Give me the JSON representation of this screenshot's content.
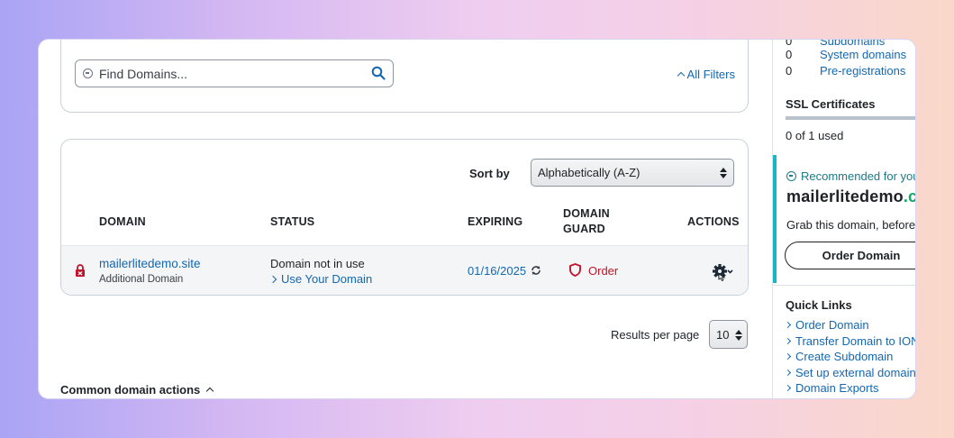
{
  "search": {
    "placeholder": "Find Domains...",
    "all_filters_label": "All Filters"
  },
  "sort": {
    "label": "Sort by",
    "selected": "Alphabetically (A-Z)"
  },
  "table": {
    "headers": {
      "domain": "DOMAIN",
      "status": "STATUS",
      "expiring": "EXPIRING",
      "domain_guard": "DOMAIN GUARD",
      "actions": "ACTIONS"
    },
    "rows": [
      {
        "domain": "mailerlitedemo.site",
        "type": "Additional Domain",
        "status": "Domain not in use",
        "status_action": "Use Your Domain",
        "expiring": "01/16/2025",
        "guard_action": "Order"
      }
    ]
  },
  "pagination": {
    "results_per_page_label": "Results per page",
    "results_per_page_value": "10"
  },
  "common_actions": {
    "label": "Common domain actions"
  },
  "sidebar": {
    "stats": [
      {
        "count": "0",
        "label": "Subdomains"
      },
      {
        "count": "0",
        "label": "System domains"
      },
      {
        "count": "0",
        "label": "Pre-registrations"
      }
    ],
    "ssl": {
      "heading": "SSL Certificates",
      "used": "0 of 1 used"
    },
    "recommended": {
      "heading": "Recommended for you",
      "domain_name": "mailerlitedemo",
      "domain_tld": ".c",
      "description": "Grab this domain, before",
      "button": "Order Domain"
    },
    "quick_links": {
      "heading": "Quick Links",
      "items": [
        "Order Domain",
        "Transfer Domain to IONOS",
        "Create Subdomain",
        "Set up external domain",
        "Domain Exports"
      ]
    }
  },
  "colors": {
    "link": "#1567b0",
    "danger": "#c0152a",
    "accent_teal": "#19b6c8",
    "tld_green": "#0ea86a"
  }
}
